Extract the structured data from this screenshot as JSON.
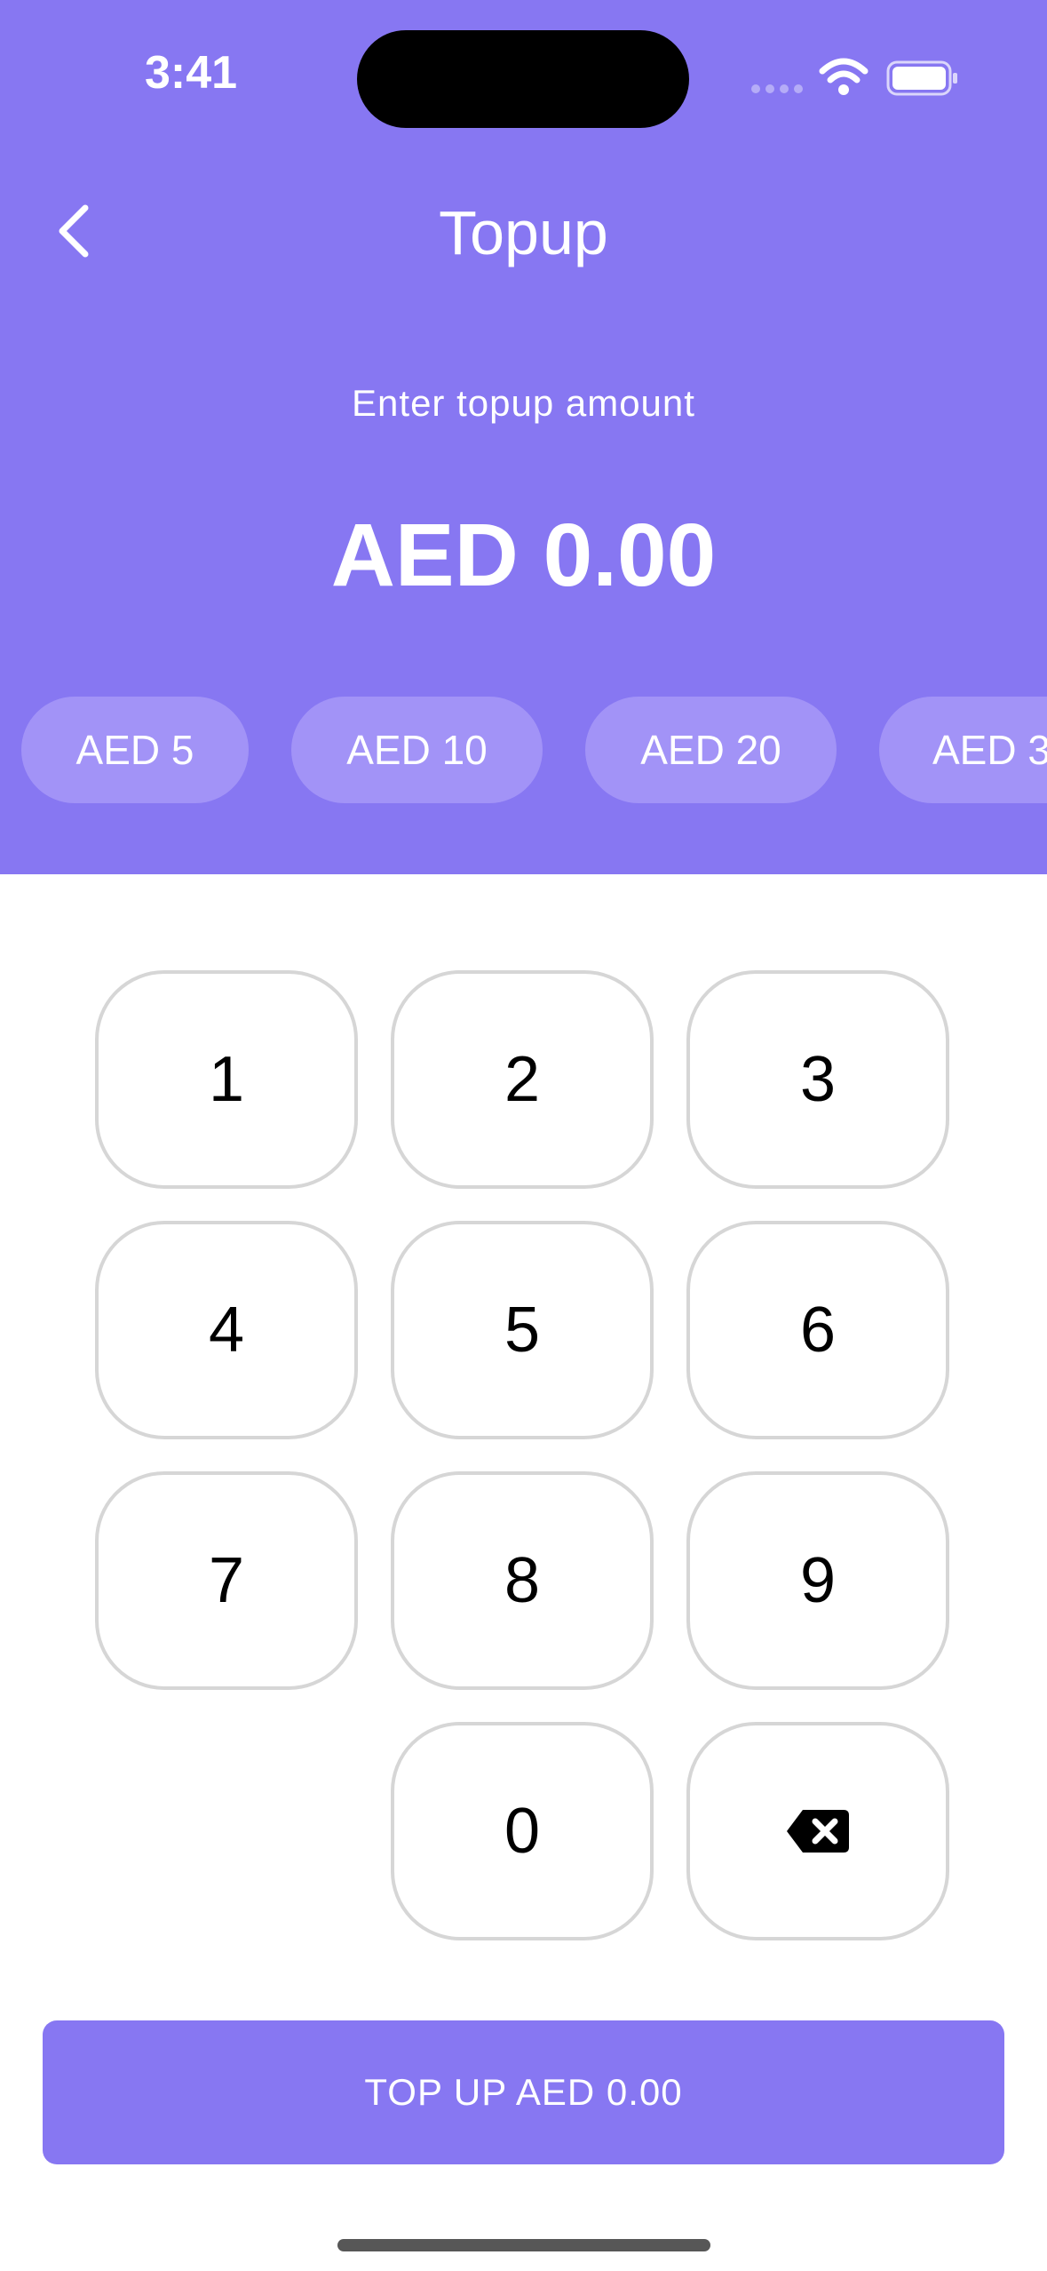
{
  "status_bar": {
    "time": "3:41",
    "icons": [
      "signal-icon",
      "wifi-icon",
      "battery-icon"
    ]
  },
  "nav": {
    "back_icon": "chevron-left-icon",
    "title": "Topup"
  },
  "prompt": "Enter topup amount",
  "amount": "AED 0.00",
  "quick_amounts": [
    "AED 5",
    "AED 10",
    "AED 20",
    "AED 3"
  ],
  "keypad": {
    "keys": [
      "1",
      "2",
      "3",
      "4",
      "5",
      "6",
      "7",
      "8",
      "9",
      "0"
    ],
    "delete_icon": "backspace-icon"
  },
  "cta_label": "TOP UP AED 0.00",
  "colors": {
    "primary": "#8777f2",
    "chip": "#a293f7",
    "key_border": "#d6d6d6"
  }
}
